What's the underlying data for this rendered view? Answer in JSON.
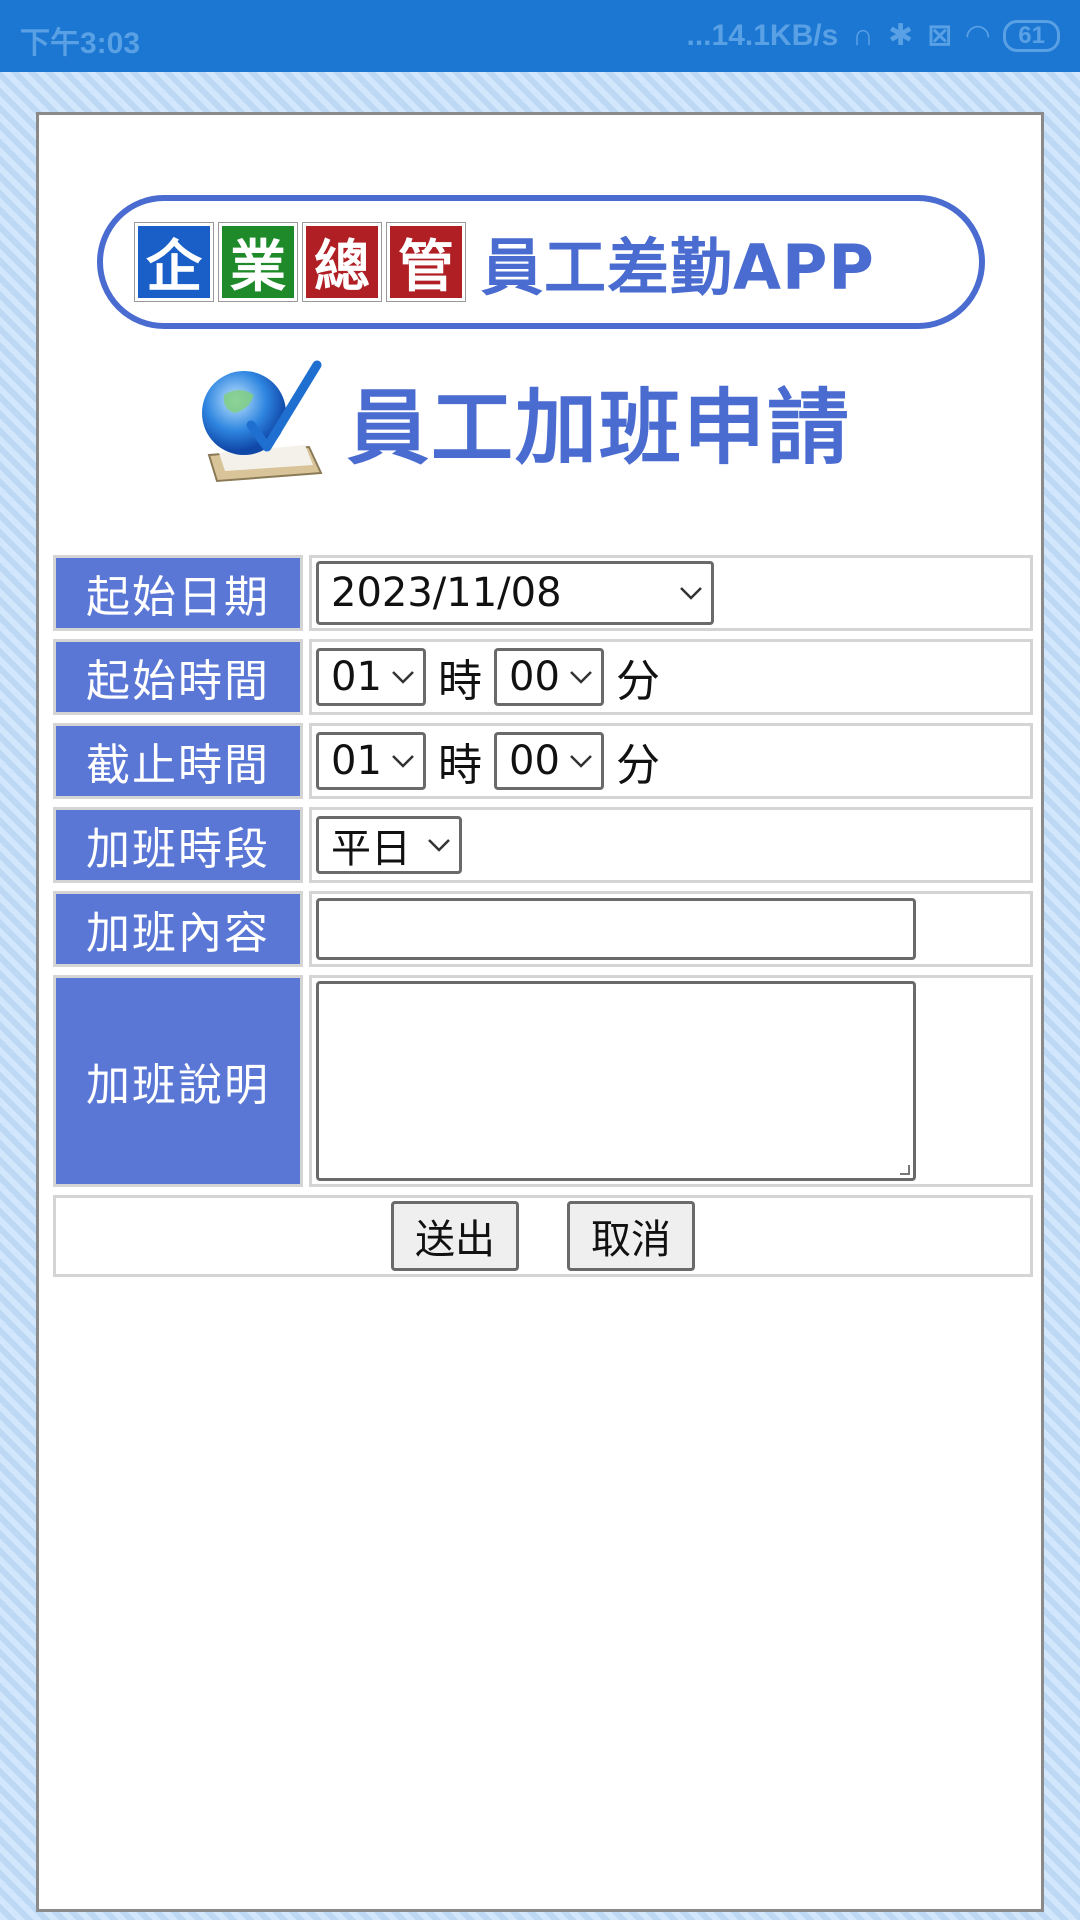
{
  "status_bar": {
    "time": "下午3:03",
    "network_speed": "...14.1KB/s",
    "battery": "61",
    "icons": [
      "headphone-icon",
      "bluetooth-icon",
      "sim-off-icon",
      "wifi-icon",
      "battery-icon"
    ]
  },
  "banner": {
    "tiles": [
      "企",
      "業",
      "總",
      "管"
    ],
    "tile_colors": [
      "#1a5ec8",
      "#1e8a2a",
      "#b01f24",
      "#b01f24"
    ],
    "title": "員工差勤APP",
    "accent": "#4a6cd0"
  },
  "heading": {
    "icon": "globe-checklist-icon",
    "title": "員工加班申請"
  },
  "form": {
    "label_color": "#5a77d6",
    "start_date": {
      "label": "起始日期",
      "value": "2023/11/08"
    },
    "start_time": {
      "label": "起始時間",
      "hour": "01",
      "hour_unit": "時",
      "minute": "00",
      "minute_unit": "分"
    },
    "end_time": {
      "label": "截止時間",
      "hour": "01",
      "hour_unit": "時",
      "minute": "00",
      "minute_unit": "分"
    },
    "period": {
      "label": "加班時段",
      "value": "平日"
    },
    "content": {
      "label": "加班內容",
      "value": ""
    },
    "description": {
      "label": "加班說明",
      "value": ""
    },
    "submit_label": "送出",
    "cancel_label": "取消"
  }
}
